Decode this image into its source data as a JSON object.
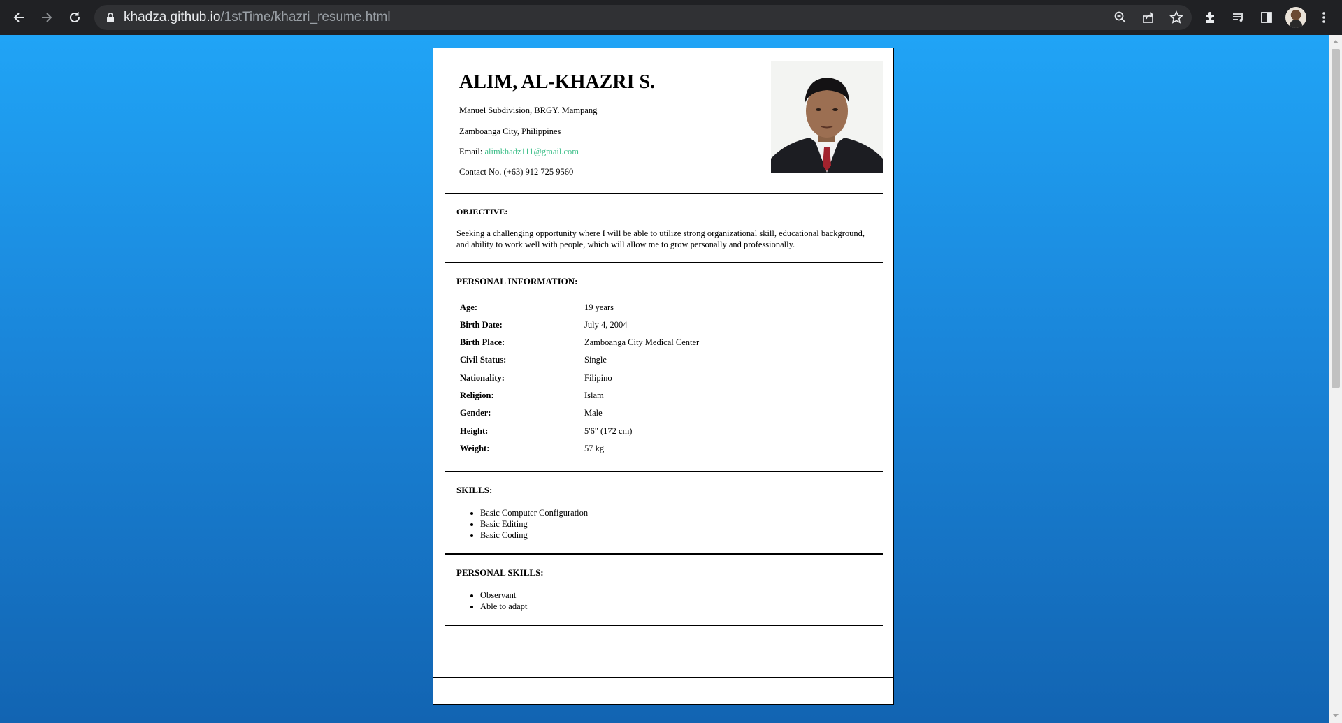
{
  "browser": {
    "url_host": "khadza.github.io",
    "url_path": "/1stTime/khazri_resume.html"
  },
  "resume": {
    "name": "ALIM, AL-KHAZRI S.",
    "address_line1": "Manuel Subdivision, BRGY. Mampang",
    "address_line2": "Zamboanga City, Philippines",
    "email_label": "Email:",
    "email": "alimkhadz111@gmail.com",
    "contact": "Contact No. (+63) 912 725 9560",
    "objective": {
      "title": "OBJECTIVE:",
      "text": "Seeking a challenging opportunity where I will be able to utilize strong organizational skill, educational background, and ability to work well with people, which will allow me to grow personally and professionally."
    },
    "personal_info": {
      "title": "PERSONAL INFORMATION:",
      "rows": [
        {
          "label": "Age:",
          "value": "19 years"
        },
        {
          "label": "Birth Date:",
          "value": "July 4, 2004"
        },
        {
          "label": "Birth Place:",
          "value": "Zamboanga City Medical Center"
        },
        {
          "label": "Civil Status:",
          "value": "Single"
        },
        {
          "label": "Nationality:",
          "value": "Filipino"
        },
        {
          "label": "Religion:",
          "value": "Islam"
        },
        {
          "label": "Gender:",
          "value": "Male"
        },
        {
          "label": "Height:",
          "value": "5'6\" (172 cm)"
        },
        {
          "label": "Weight:",
          "value": "57 kg"
        }
      ]
    },
    "skills": {
      "title": "SKILLS:",
      "items": [
        "Basic Computer Configuration",
        "Basic Editing",
        "Basic Coding"
      ]
    },
    "personal_skills": {
      "title": "PERSONAL SKILLS:",
      "items": [
        "Observant",
        "Able to adapt"
      ]
    }
  },
  "colors": {
    "background_top": "#20a4f6",
    "background_bottom": "#1264b2",
    "email_link": "#3fbf8a"
  }
}
